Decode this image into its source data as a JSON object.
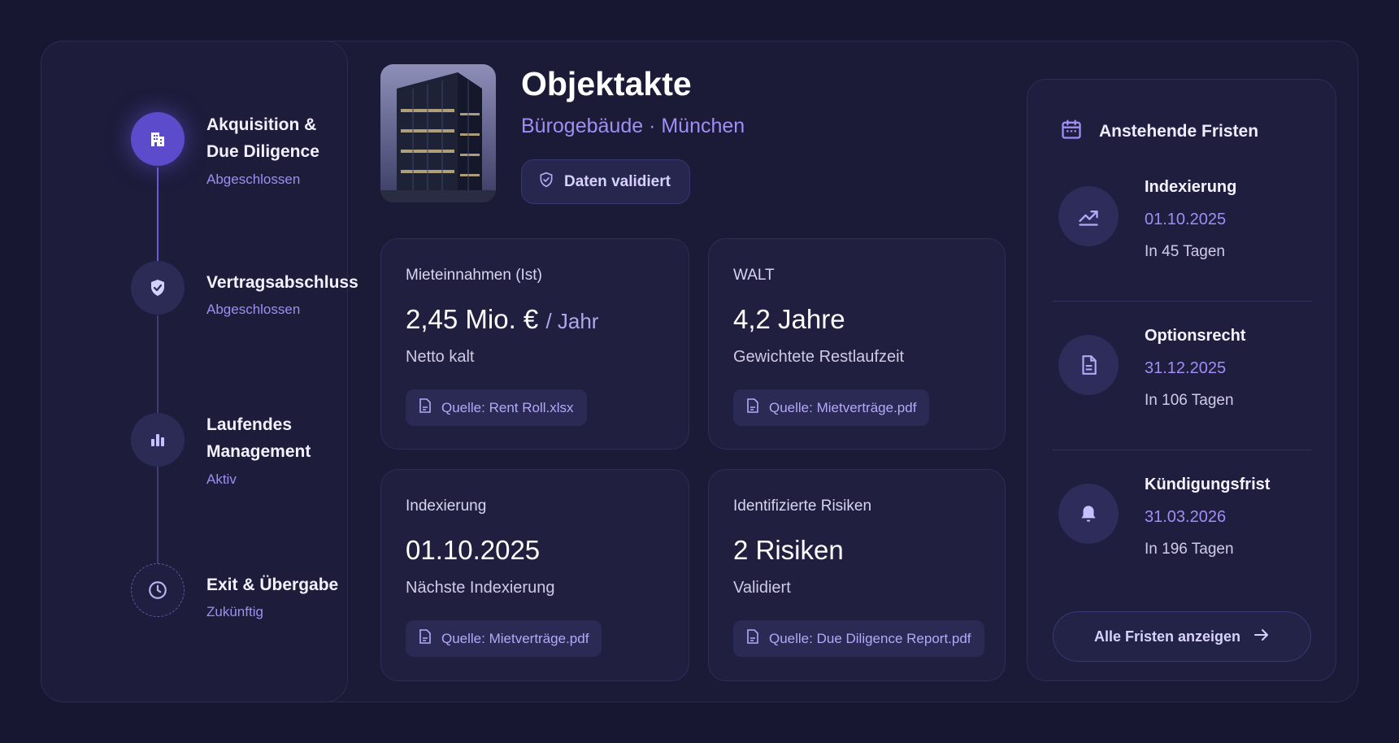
{
  "timeline": {
    "steps": [
      {
        "title_line1": "Akquisition &",
        "title_line2": "Due Diligence",
        "status": "Abgeschlossen",
        "icon": "building-icon",
        "state": "current"
      },
      {
        "title_line1": "Vertragsabschluss",
        "title_line2": "",
        "status": "Abgeschlossen",
        "icon": "shield-check-icon",
        "state": "done"
      },
      {
        "title_line1": "Laufendes",
        "title_line2": "Management",
        "status": "Aktiv",
        "icon": "bar-chart-icon",
        "state": "done"
      },
      {
        "title_line1": "Exit & Übergabe",
        "title_line2": "",
        "status": "Zukünftig",
        "icon": "clock-icon",
        "state": "future"
      }
    ]
  },
  "header": {
    "title": "Objektakte",
    "subtitle": "Bürogebäude · München",
    "badge": "Daten validiert"
  },
  "cards": [
    {
      "label": "Mieteinnahmen (Ist)",
      "value": "2,45 Mio. €",
      "unit": "/ Jahr",
      "note": "Netto kalt",
      "source": "Quelle: Rent Roll.xlsx"
    },
    {
      "label": "WALT",
      "value": "4,2 Jahre",
      "unit": "",
      "note": "Gewichtete Restlaufzeit",
      "source": "Quelle: Mietverträge.pdf"
    },
    {
      "label": "Indexierung",
      "value": "01.10.2025",
      "unit": "",
      "note": "Nächste Indexierung",
      "source": "Quelle: Mietverträge.pdf"
    },
    {
      "label": "Identifizierte Risiken",
      "value": "2 Risiken",
      "unit": "",
      "note": "Validiert",
      "source": "Quelle: Due Diligence Report.pdf"
    }
  ],
  "deadlines": {
    "title": "Anstehende Fristen",
    "items": [
      {
        "title": "Indexierung",
        "date": "01.10.2025",
        "days": "In 45 Tagen",
        "icon": "trend-up-icon"
      },
      {
        "title": "Optionsrecht",
        "date": "31.12.2025",
        "days": "In 106 Tagen",
        "icon": "document-icon"
      },
      {
        "title": "Kündigungsfrist",
        "date": "31.03.2026",
        "days": "In 196 Tagen",
        "icon": "bell-icon"
      }
    ],
    "button": "Alle Fristen anzeigen"
  },
  "colors": {
    "background": "#181731",
    "accent": "#5c4ccc",
    "accent_text": "#9d8ff5"
  }
}
